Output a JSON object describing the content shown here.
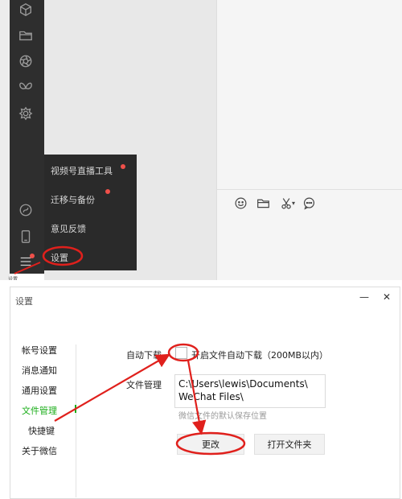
{
  "top_window": {
    "sidebar_icons": [
      "cube-icon",
      "folder-icon",
      "aperture-icon",
      "butterfly-icon",
      "gear-flower-icon",
      "mini-program-icon",
      "phone-icon",
      "menu-icon"
    ],
    "toolbar_icons": [
      "emoji-icon",
      "folder-icon",
      "scissors-icon",
      "chat-bubble-icon"
    ],
    "menu_items": [
      {
        "label": "视频号直播工具",
        "dot": true
      },
      {
        "label": "迁移与备份",
        "dot": true
      },
      {
        "label": "意见反馈",
        "dot": false
      },
      {
        "label": "设置",
        "dot": false
      }
    ],
    "caption": "设置"
  },
  "settings": {
    "title": "设置",
    "minimize": "—",
    "close": "✕",
    "nav": [
      {
        "label": "帐号设置",
        "active": false
      },
      {
        "label": "消息通知",
        "active": false
      },
      {
        "label": "通用设置",
        "active": false
      },
      {
        "label": "文件管理",
        "active": true
      },
      {
        "label": "快捷键",
        "active": false
      },
      {
        "label": "关于微信",
        "active": false
      }
    ],
    "auto_download_label": "自动下载",
    "auto_download_text": "开启文件自动下载（200MB以内）",
    "file_mgmt_label": "文件管理",
    "path_line1": "C:\\Users\\lewis\\Documents\\",
    "path_line2": "WeChat Files\\",
    "hint": "微信文件的默认保存位置",
    "change_button": "更改",
    "open_folder_button": "打开文件夹"
  },
  "colors": {
    "accent": "#1aad19",
    "annotation": "#e0201c",
    "sidebar": "#2e2e2e"
  }
}
